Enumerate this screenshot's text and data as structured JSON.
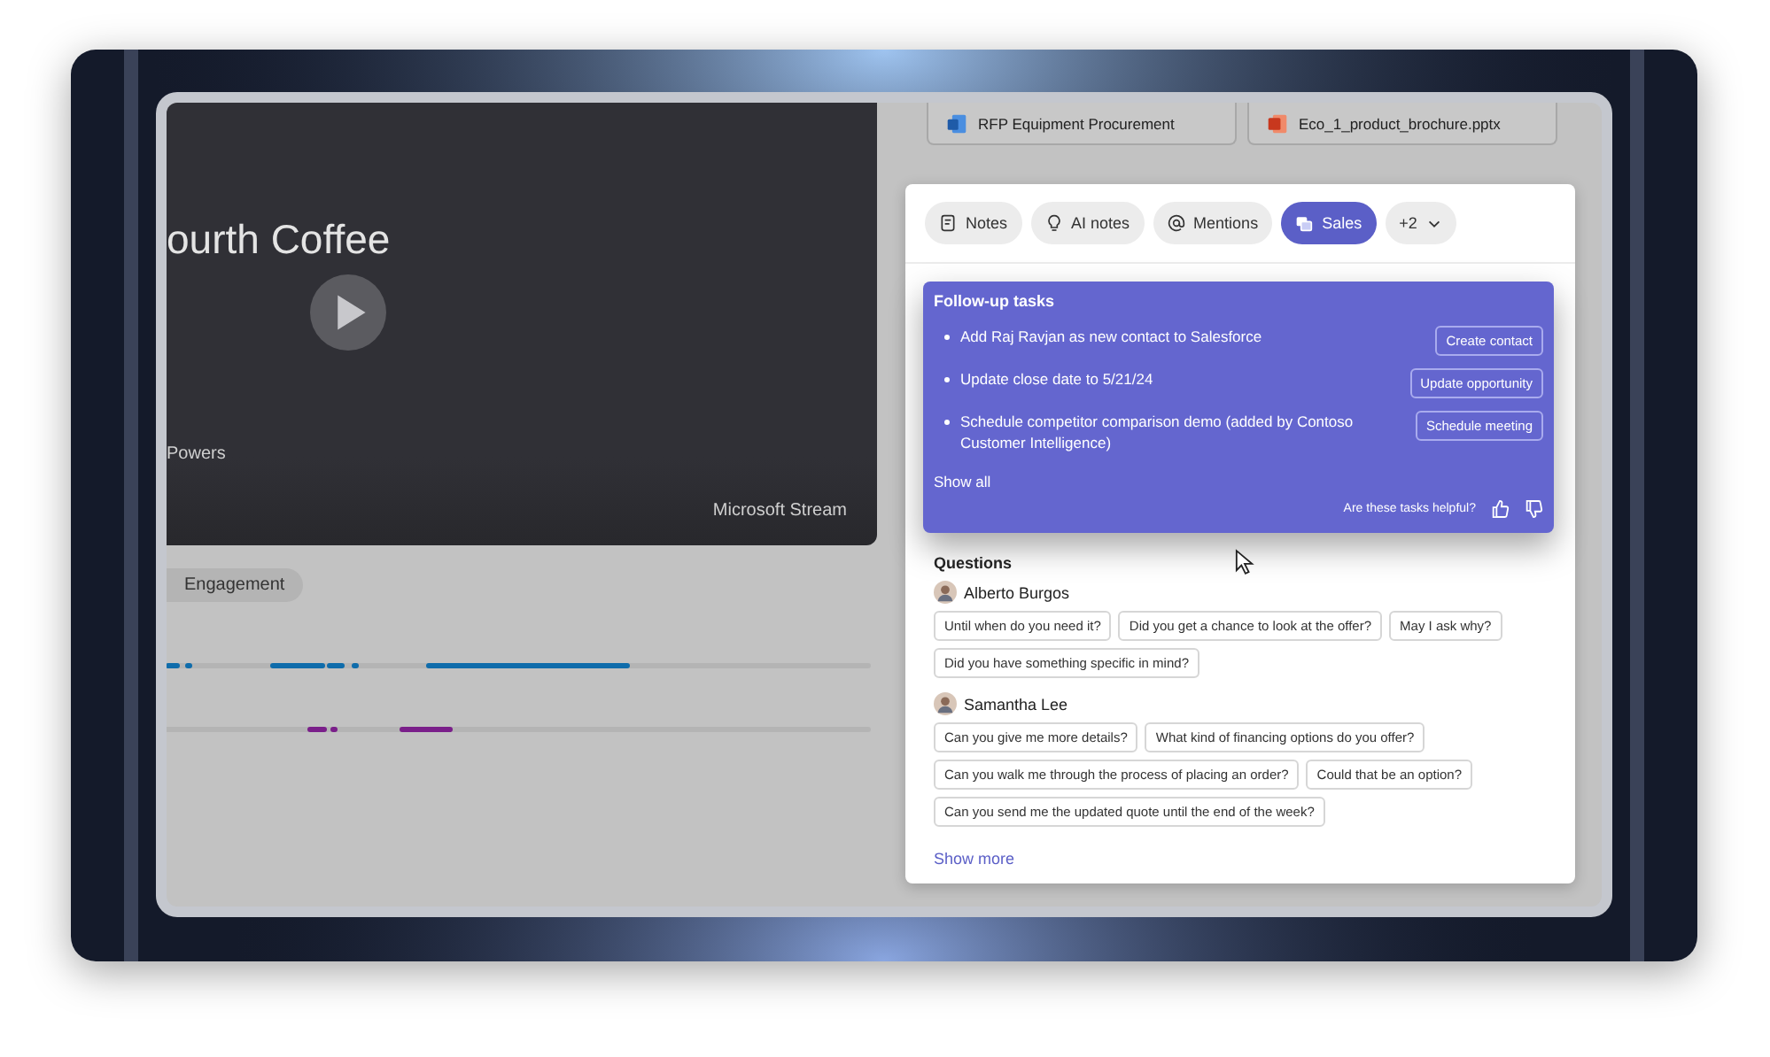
{
  "video": {
    "title": "ourth Coffee",
    "presenter": "Powers",
    "source": "Microsoft Stream"
  },
  "engagement": {
    "label": "Engagement"
  },
  "files": [
    {
      "name": "RFP Equipment Procurement",
      "kind": "word"
    },
    {
      "name": "Eco_1_product_brochure.pptx",
      "kind": "powerpoint"
    }
  ],
  "tabs": [
    {
      "label": "Notes",
      "kind": "notes",
      "selected": false
    },
    {
      "label": "AI notes",
      "kind": "bulb",
      "selected": false
    },
    {
      "label": "Mentions",
      "kind": "mention",
      "selected": false
    },
    {
      "label": "Sales",
      "kind": "sales",
      "selected": true
    },
    {
      "label": "+2",
      "kind": "more",
      "selected": false
    }
  ],
  "follow_up": {
    "title": "Follow-up tasks",
    "tasks": [
      {
        "text": "Add Raj Ravjan as new contact to Salesforce",
        "action": "Create contact"
      },
      {
        "text": "Update close date to 5/21/24",
        "action": "Update opportunity"
      },
      {
        "text": "Schedule competitor comparison demo (added by Contoso Customer Intelligence)",
        "action": "Schedule meeting"
      }
    ],
    "show_all": "Show all",
    "feedback": "Are these tasks helpful?"
  },
  "questions": {
    "title": "Questions",
    "people": [
      {
        "name": "Alberto Burgos",
        "questions": [
          "Until when do you need it?",
          "Did you get a chance to look at the offer?",
          "May I ask why?",
          "Did you have something specific in mind?"
        ]
      },
      {
        "name": "Samantha Lee",
        "questions": [
          "Can you give me more details?",
          "What kind of financing options do you offer?",
          "Can you walk me through the process of placing an order?",
          "Could that be an option?",
          "Can you send me the updated quote until the end of the week?"
        ]
      }
    ],
    "show_more": "Show more"
  }
}
